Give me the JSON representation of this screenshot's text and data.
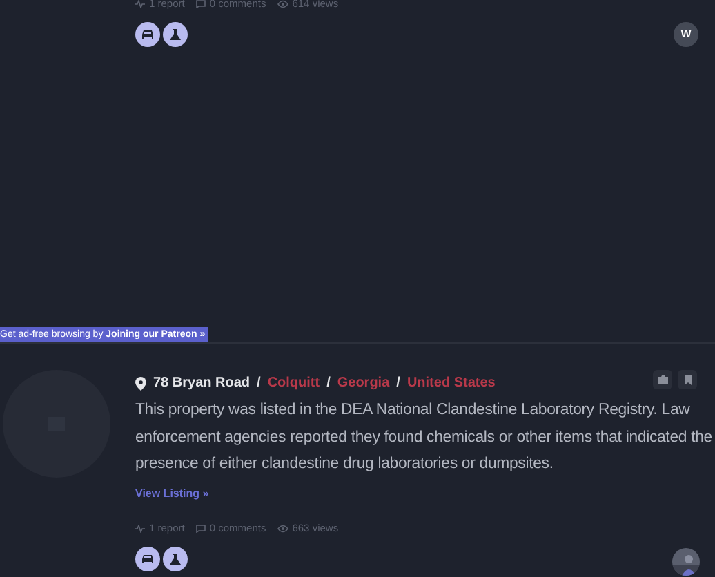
{
  "listings": [
    {
      "stats": {
        "reports": "1 report",
        "comments": "0 comments",
        "views": "614 views"
      },
      "tags": [
        {
          "kind": "vehicle"
        },
        {
          "kind": "lab"
        }
      ],
      "user_initial": "W"
    },
    {
      "address": "78 Bryan Road",
      "location": [
        {
          "text": "Colquitt"
        },
        {
          "text": "Georgia"
        },
        {
          "text": "United States"
        }
      ],
      "separator": "/",
      "description": "This property was listed in the DEA National Clandestine Laboratory Registry. Law enforcement agencies reported they found chemicals or other items that indicated the presence of either clandestine drug laboratories or dumpsites.",
      "link": "View Listing »",
      "stats": {
        "reports": "1 report",
        "comments": "0 comments",
        "views": "663 views"
      },
      "tags": [
        {
          "kind": "vehicle"
        },
        {
          "kind": "lab"
        }
      ],
      "user_avatar": {
        "kind": "picture"
      }
    }
  ],
  "banner": {
    "text": "Get ad-free browsing by **Joining our Patreon »**"
  }
}
